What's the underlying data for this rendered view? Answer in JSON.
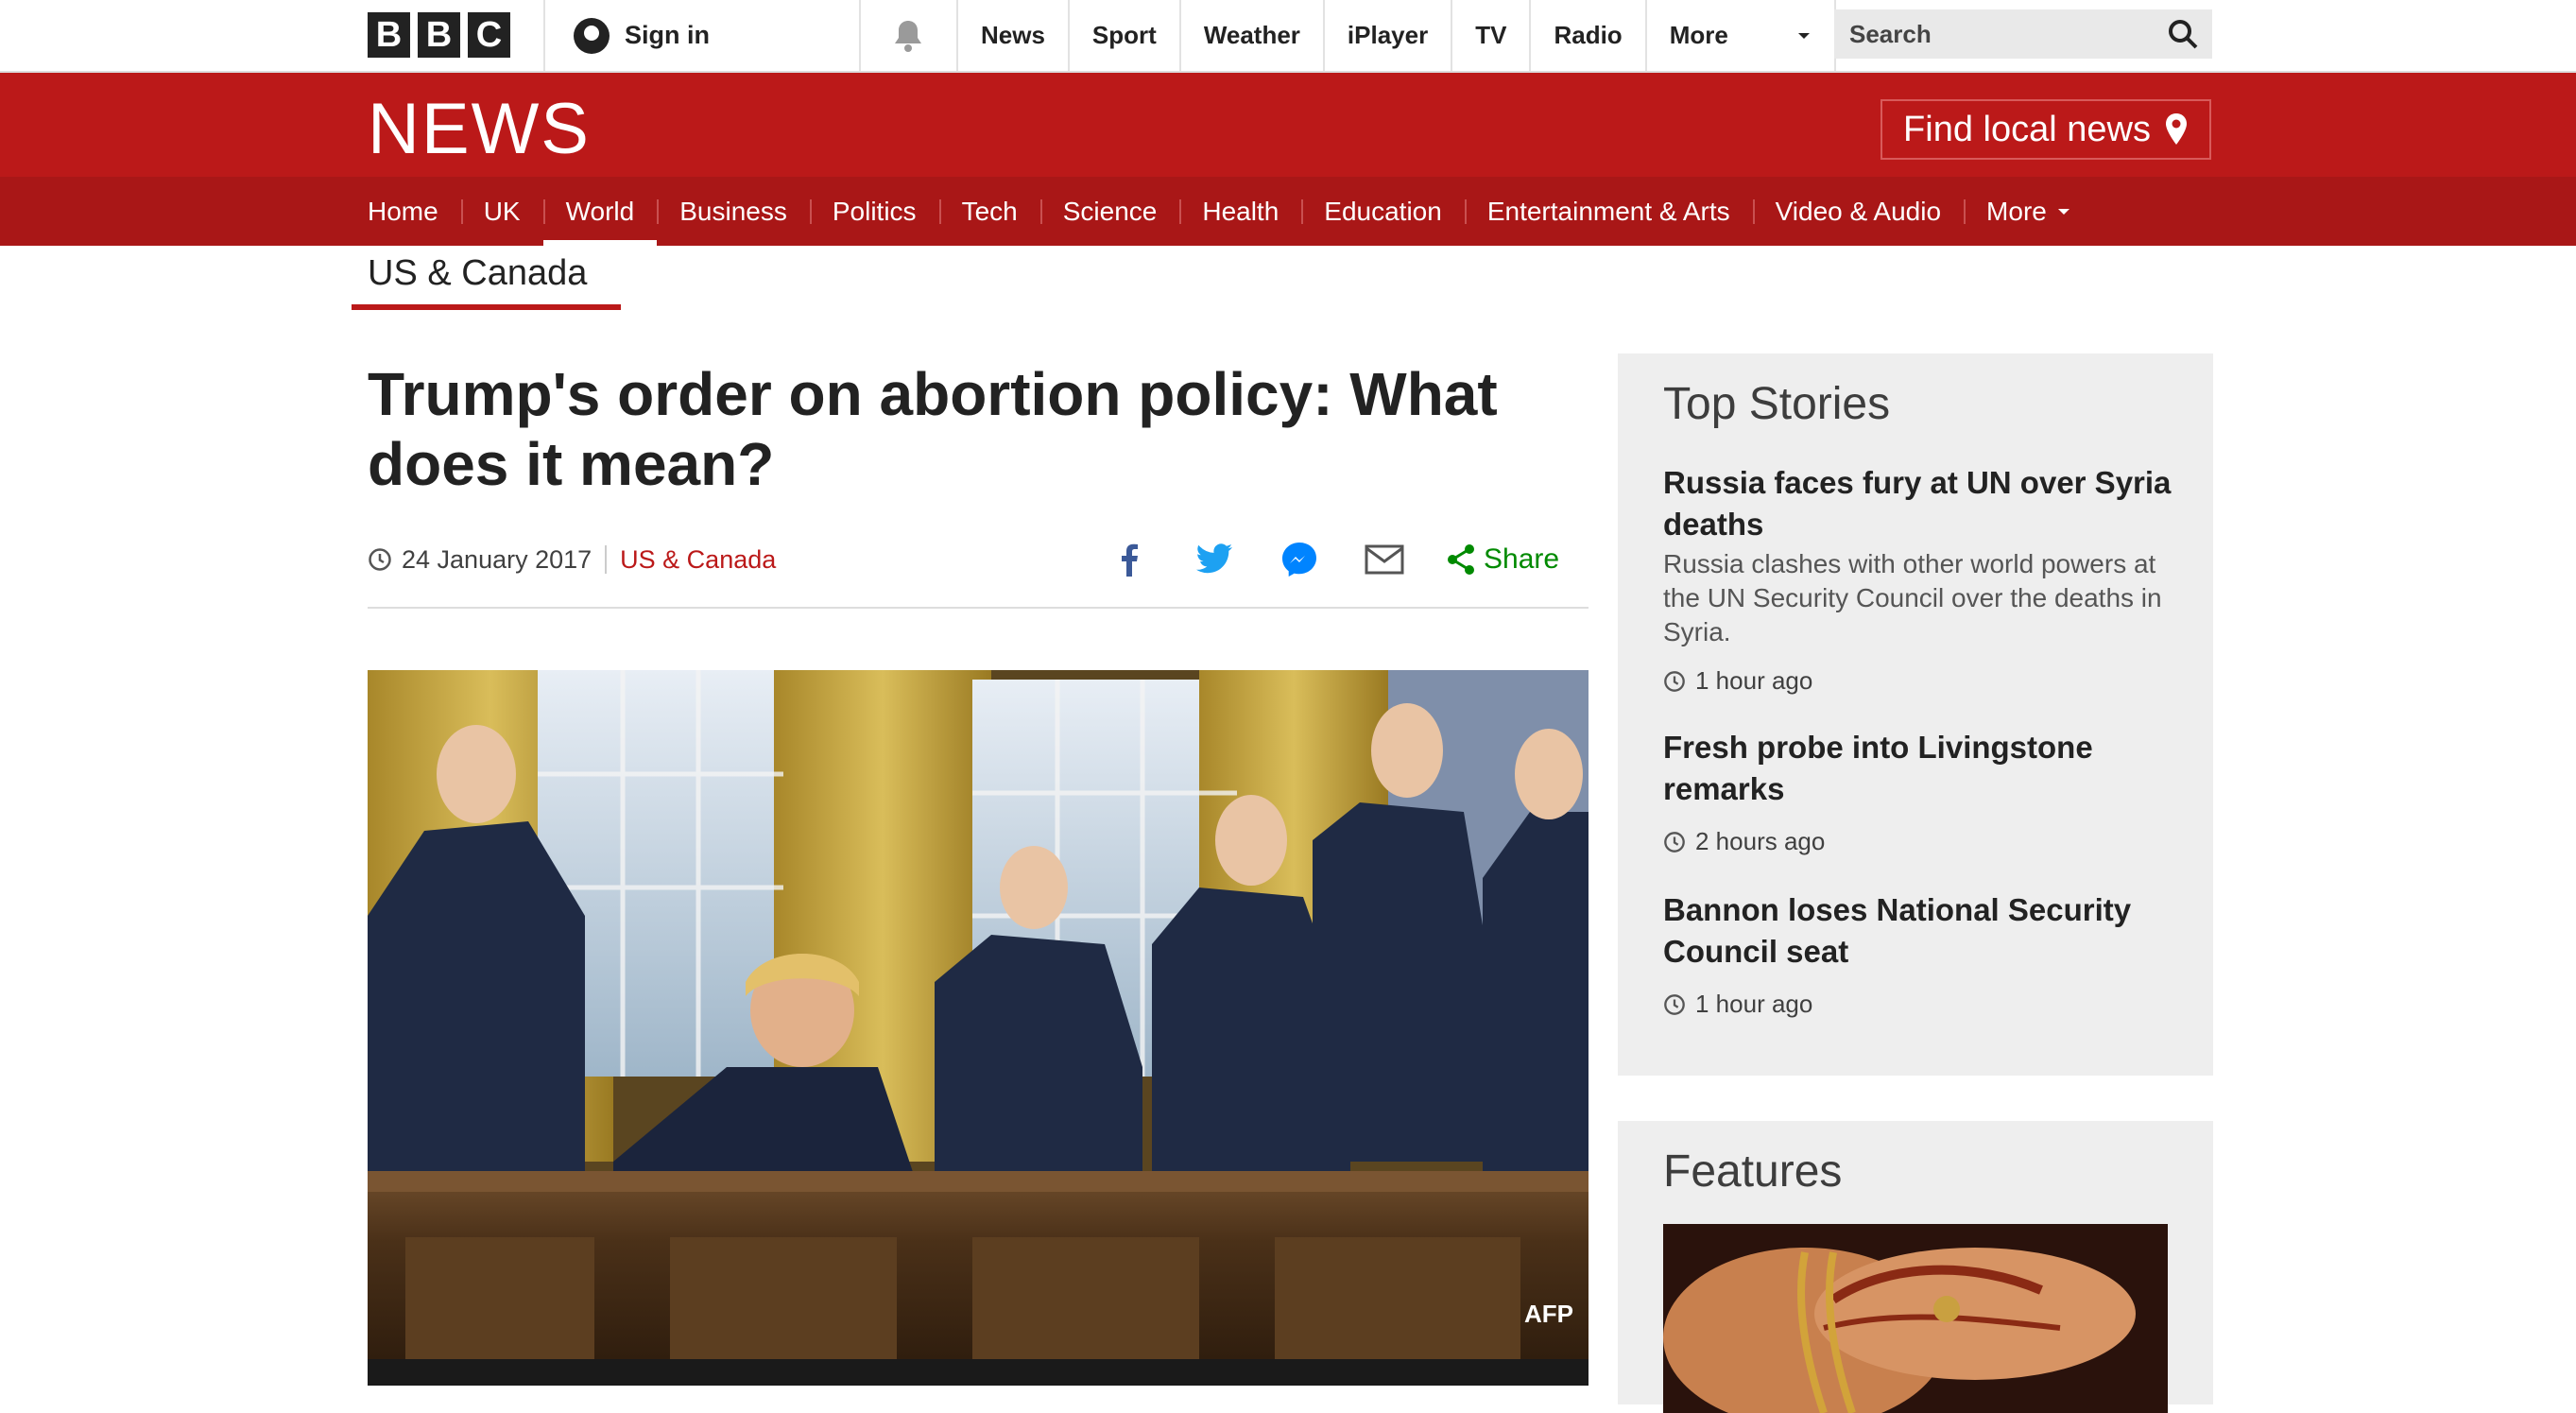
{
  "topbar": {
    "logo": [
      "B",
      "B",
      "C"
    ],
    "signin_label": "Sign in",
    "nav": [
      "News",
      "Sport",
      "Weather",
      "iPlayer",
      "TV",
      "Radio"
    ],
    "more_label": "More",
    "search_placeholder": "Search"
  },
  "masthead": {
    "title": "NEWS",
    "find_local": "Find local news"
  },
  "section_nav": {
    "items": [
      "Home",
      "UK",
      "World",
      "Business",
      "Politics",
      "Tech",
      "Science",
      "Health",
      "Education",
      "Entertainment & Arts",
      "Video & Audio"
    ],
    "active": "World",
    "more_label": "More"
  },
  "subnav": {
    "title": "US & Canada"
  },
  "article": {
    "headline": "Trump's order on abortion policy: What does it mean?",
    "date": "24 January 2017",
    "category": "US & Canada",
    "share_label": "Share",
    "image_credit": "AFP"
  },
  "sidebar": {
    "top_stories_title": "Top Stories",
    "stories": [
      {
        "headline": "Russia faces fury at UN over Syria deaths",
        "summary": "Russia clashes with other world powers at the UN Security Council over the deaths in Syria.",
        "time": "1 hour ago"
      },
      {
        "headline": "Fresh probe into Livingstone remarks",
        "summary": "",
        "time": "2 hours ago"
      },
      {
        "headline": "Bannon loses National Security Council seat",
        "summary": "",
        "time": "1 hour ago"
      }
    ],
    "features_title": "Features"
  },
  "colors": {
    "bbc_red": "#bb1919",
    "nav_red": "#a91717",
    "share_green": "#008a00",
    "sidebar_bg": "#eeeeee"
  }
}
